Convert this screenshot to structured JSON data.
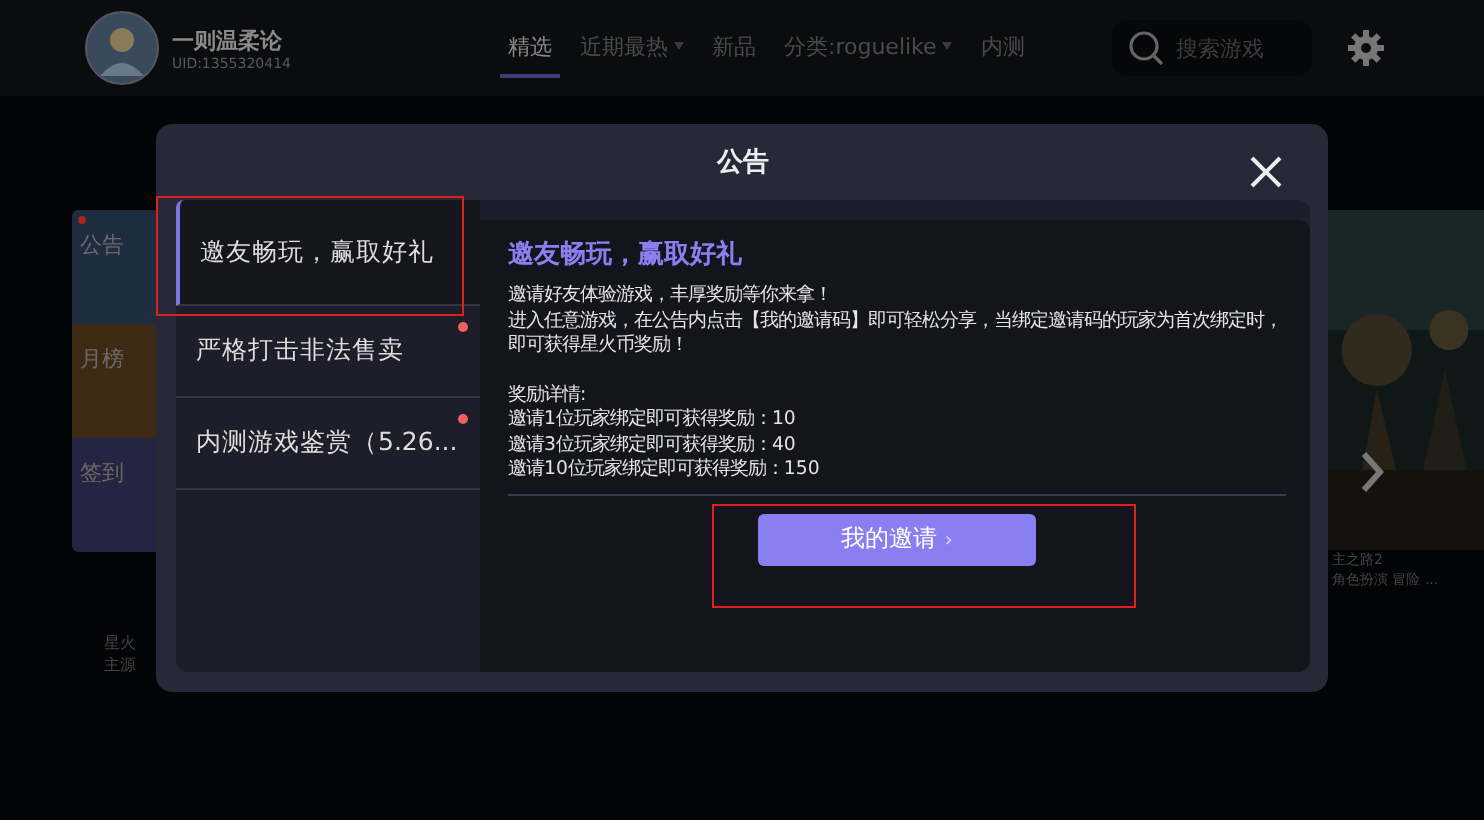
{
  "user": {
    "name": "一则温柔论",
    "uid": "UID:1355320414"
  },
  "nav_tabs": [
    {
      "label": "精选",
      "selected": true,
      "dropdown": false
    },
    {
      "label": "近期最热",
      "selected": false,
      "dropdown": true
    },
    {
      "label": "新品",
      "selected": false,
      "dropdown": false
    },
    {
      "label": "分类:roguelike",
      "selected": false,
      "dropdown": true
    },
    {
      "label": "内测",
      "selected": false,
      "dropdown": false
    }
  ],
  "search": {
    "placeholder": "搜索游戏"
  },
  "side_tiles": [
    {
      "label": "公告",
      "color": "#1e2c40",
      "unread": true
    },
    {
      "label": "月榜",
      "color": "#3e2a14",
      "unread": false
    },
    {
      "label": "签到",
      "color": "#262440",
      "unread": false
    }
  ],
  "bottom_label": [
    "星火",
    "主源"
  ],
  "game_card": {
    "kind": "picture",
    "title": "主之路2",
    "tags": "角色扮演 冒险 ..."
  },
  "dialog": {
    "title": "公告",
    "items": [
      {
        "label": "邀友畅玩，赢取好礼",
        "selected": true,
        "unread": false,
        "highlighted": true
      },
      {
        "label": "严格打击非法售卖",
        "selected": false,
        "unread": true,
        "highlighted": false
      },
      {
        "label": "内测游戏鉴赏（5.26...",
        "selected": false,
        "unread": true,
        "highlighted": false
      }
    ],
    "content": {
      "title": "邀友畅玩，赢取好礼",
      "paragraphs": [
        [
          "邀请好友体验游戏，丰厚奖励等你来拿！",
          "进入任意游戏，在公告内点击【我的邀请码】即可轻松分享，当绑定邀请码的玩家为首次绑定时，即可获得星火币奖励！"
        ],
        [
          "奖励详情:",
          "邀请1位玩家绑定即可获得奖励：10",
          "邀请3位玩家绑定即可获得奖励：40",
          "邀请10位玩家绑定即可获得奖励：150"
        ]
      ]
    },
    "button": {
      "label": "我的邀请",
      "icon": "›",
      "highlighted": true
    }
  }
}
